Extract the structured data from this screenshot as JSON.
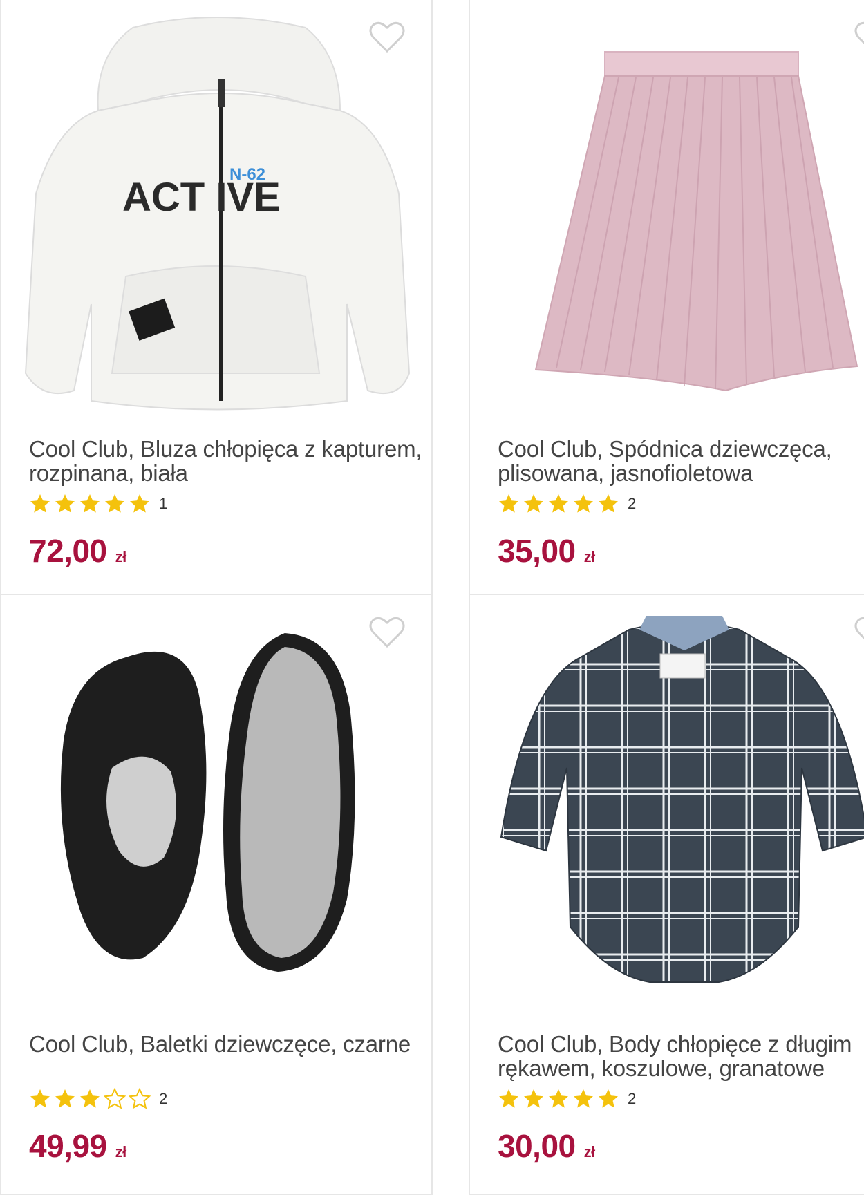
{
  "currency": "zł",
  "colors": {
    "price": "#a8123e",
    "star": "#f4c20d",
    "heart": "#cfcfcf"
  },
  "products": [
    {
      "title": "Cool Club, Bluza chłopięca z kapturem, rozpinana, biała",
      "rating": 5,
      "reviews": "1",
      "price": "72,00",
      "image": "white-zip-hoodie",
      "hoodie_text": "ACT IVE",
      "hoodie_badge": "N-62"
    },
    {
      "title": "Cool Club, Spódnica dziewczęca, plisowana, jasnofioletowa",
      "rating": 5,
      "reviews": "2",
      "price": "35,00",
      "image": "pink-pleated-skirt"
    },
    {
      "title": "Cool Club, Baletki dziewczęce, czarne",
      "rating": 3,
      "reviews": "2",
      "price": "49,99",
      "image": "black-ballet-flats"
    },
    {
      "title": "Cool Club, Body chłopięce z długim rękawem, koszulowe, granatowe",
      "rating": 5,
      "reviews": "2",
      "price": "30,00",
      "image": "navy-plaid-shirt-bodysuit"
    }
  ]
}
